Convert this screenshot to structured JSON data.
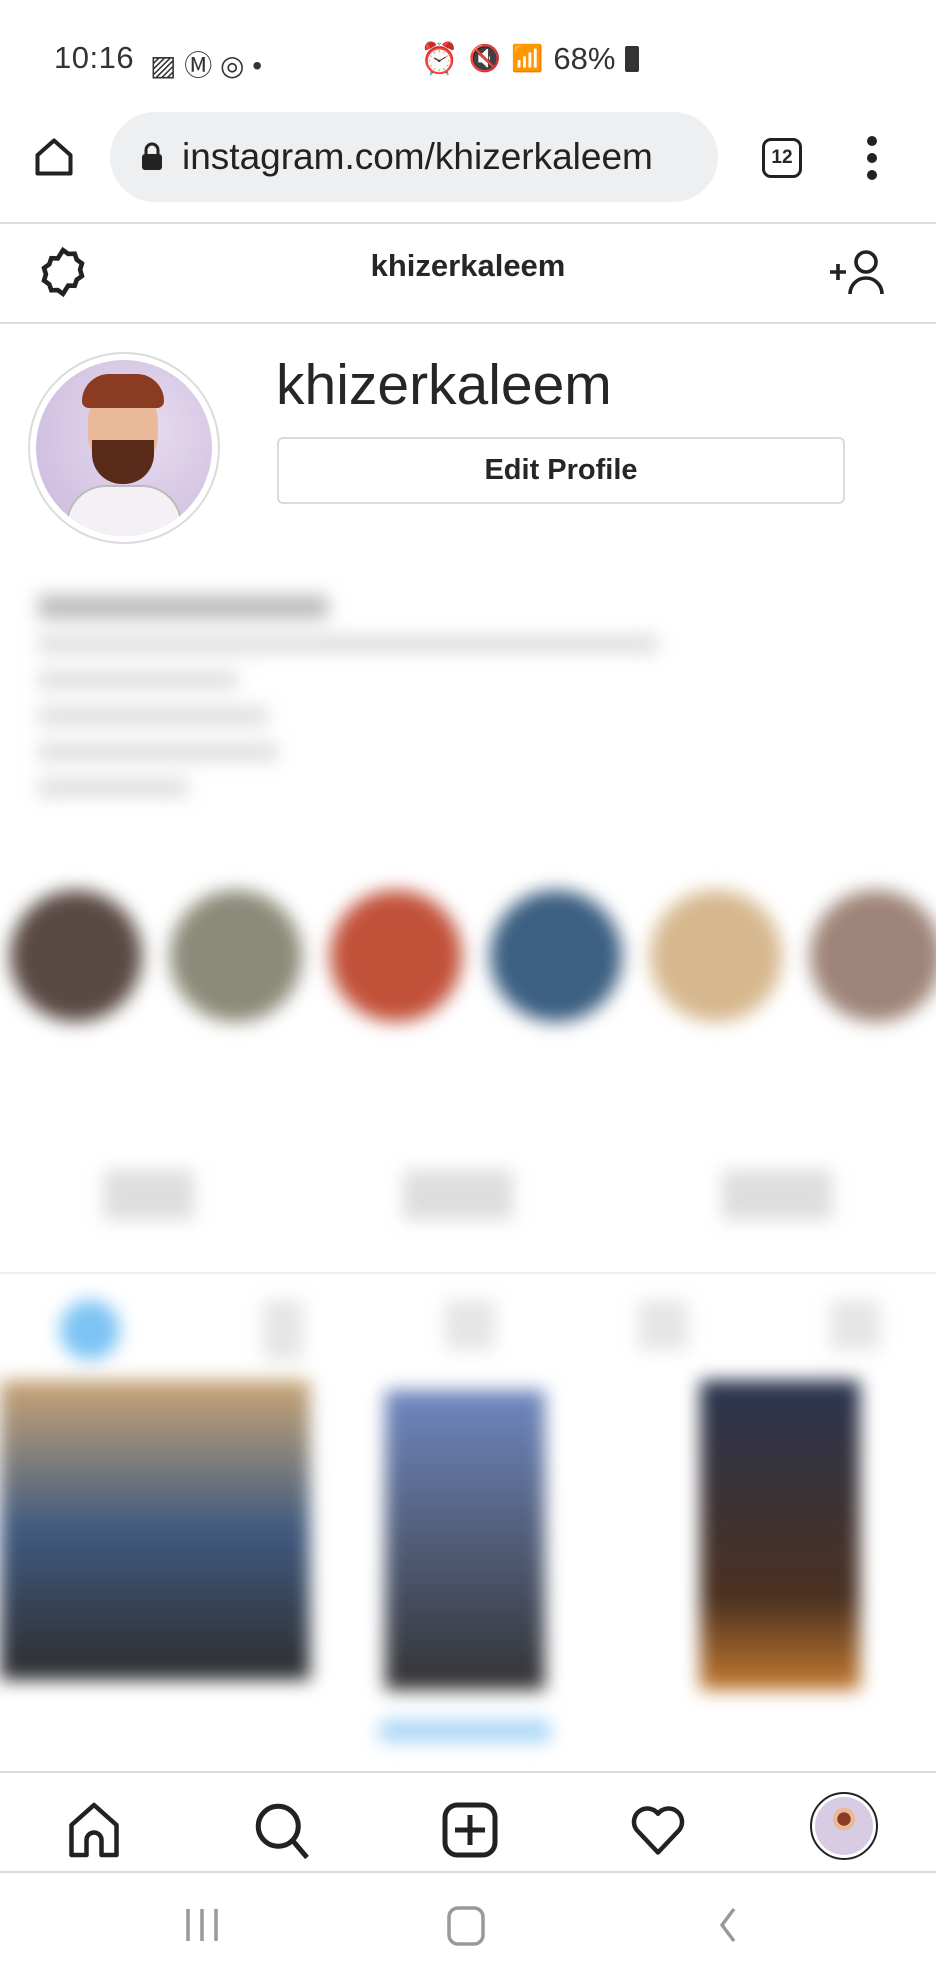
{
  "status_bar": {
    "time": "10:16",
    "battery": "68%",
    "icons": [
      "gallery-icon",
      "gmail-icon",
      "instagram-icon",
      "alarm-icon",
      "mute-icon",
      "wifi-icon",
      "signal-icon",
      "battery-icon"
    ]
  },
  "browser": {
    "url": "instagram.com/khizerkaleem",
    "tab_count": "12"
  },
  "header": {
    "title": "khizerkaleem"
  },
  "profile": {
    "username": "khizerkaleem",
    "edit_button": "Edit Profile"
  },
  "colors": {
    "accent": "#0095f6",
    "border": "#dbdbdb",
    "url_bg": "#eeeff1"
  }
}
